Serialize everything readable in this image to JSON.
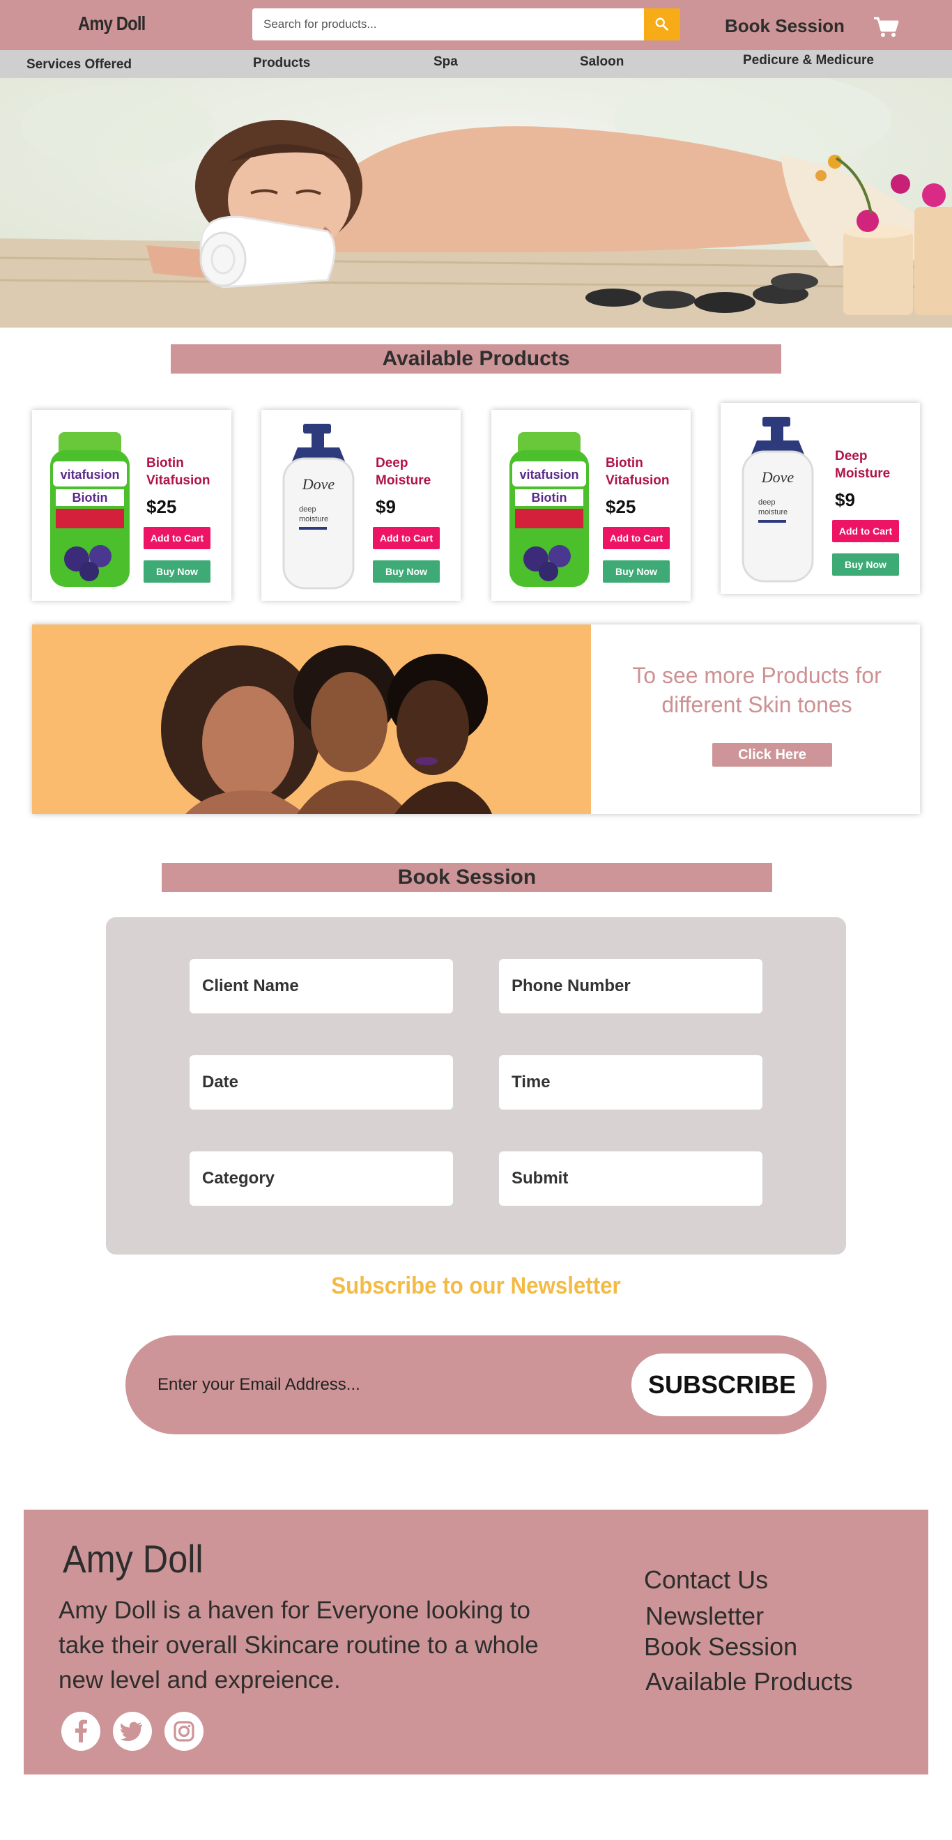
{
  "header": {
    "logo": "Amy Doll",
    "search_placeholder": "Search for products...",
    "book_session": "Book Session"
  },
  "nav": {
    "items": [
      "Services Offered",
      "Products",
      "Spa",
      "Saloon",
      "Pedicure & Medicure"
    ]
  },
  "products_section": {
    "title": "Available Products",
    "items": [
      {
        "name": "Biotin Vitafusion",
        "price": "$25",
        "add_to_cart": "Add to Cart",
        "buy_now": "Buy Now"
      },
      {
        "name": "Deep Moisture",
        "price": "$9",
        "add_to_cart": "Add to Cart",
        "buy_now": "Buy Now"
      },
      {
        "name": "Biotin Vitafusion",
        "price": "$25",
        "add_to_cart": "Add to Cart",
        "buy_now": "Buy Now"
      },
      {
        "name": "Deep Moisture",
        "price": "$9",
        "add_to_cart": "Add to Cart",
        "buy_now": "Buy Now"
      }
    ]
  },
  "promo": {
    "text": "To see more Products for different Skin tones",
    "button": "Click Here"
  },
  "booking": {
    "title": "Book Session",
    "fields": {
      "client_name": "Client Name",
      "phone_number": "Phone Number",
      "date": "Date",
      "time": "Time",
      "category": "Category",
      "submit": "Submit"
    }
  },
  "newsletter": {
    "title": "Subscribe to our Newsletter",
    "email_placeholder": "Enter your Email Address...",
    "button": "SUBSCRIBE"
  },
  "footer": {
    "brand": "Amy Doll",
    "description": "Amy Doll is a haven for Everyone looking to take their overall Skincare routine to a whole new level and expreience.",
    "links": {
      "contact": "Contact Us",
      "newsletter": "Newsletter",
      "book_session": "Book Session",
      "available_products": "Available Products"
    },
    "social_icons": [
      "facebook-icon",
      "twitter-icon",
      "instagram-icon"
    ]
  },
  "colors": {
    "brand_pink": "#cd9597",
    "accent_orange": "#f7ac17",
    "cart_button": "#ee1465",
    "buy_button": "#3eaa76",
    "newsletter_title": "#f3bb45"
  }
}
